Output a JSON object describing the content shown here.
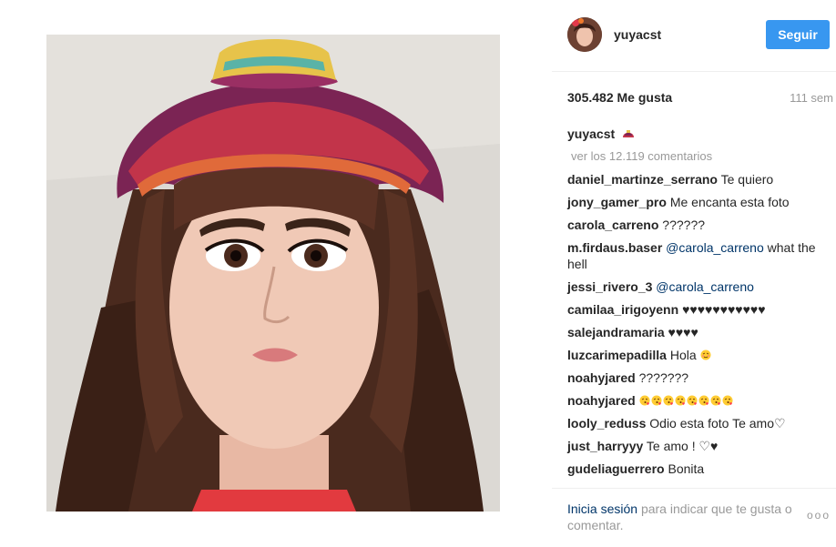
{
  "post": {
    "username": "yuyacst",
    "follow_label": "Seguir",
    "likes": "305.482 Me gusta",
    "time_ago": "111 sem",
    "caption_username": "yuyacst",
    "caption_icon": "sombrero-emoji",
    "view_comments": "ver los 12.119 comentarios"
  },
  "comments": [
    {
      "user": "daniel_martinze_serrano",
      "text": "Te quiero"
    },
    {
      "user": "jony_gamer_pro",
      "text": "Me encanta esta foto"
    },
    {
      "user": "carola_carreno",
      "text": "??????"
    },
    {
      "user": "m.firdaus.baser",
      "mention": "@carola_carreno",
      "text": "what the hell"
    },
    {
      "user": "jessi_rivero_3",
      "mention": "@carola_carreno",
      "text": ""
    },
    {
      "user": "camilaa_irigoyenn",
      "text": "♥♥♥♥♥♥♥♥♥♥♥"
    },
    {
      "user": "salejandramaria",
      "text": "♥♥♥♥"
    },
    {
      "user": "luzcarimepadilla",
      "text": "Hola",
      "emoji": "blush-emoji",
      "emoji_count": 1
    },
    {
      "user": "noahyjared",
      "text": "???????"
    },
    {
      "user": "noahyjared",
      "text": "",
      "emoji": "kiss-face-emoji",
      "emoji_count": 8
    },
    {
      "user": "looly_reduss",
      "text": "Odio esta foto Te amo♡"
    },
    {
      "user": "just_harryyy",
      "text": "Te amo ! ♡♥"
    },
    {
      "user": "gudeliaguerrero",
      "text": "Bonita"
    }
  ],
  "footer": {
    "login_link": "Inicia sesión",
    "login_rest": "para indicar que te gusta o comentar.",
    "more_label": "ooo"
  },
  "colors": {
    "accent": "#3897f0",
    "link": "#003569",
    "muted": "#999999"
  }
}
